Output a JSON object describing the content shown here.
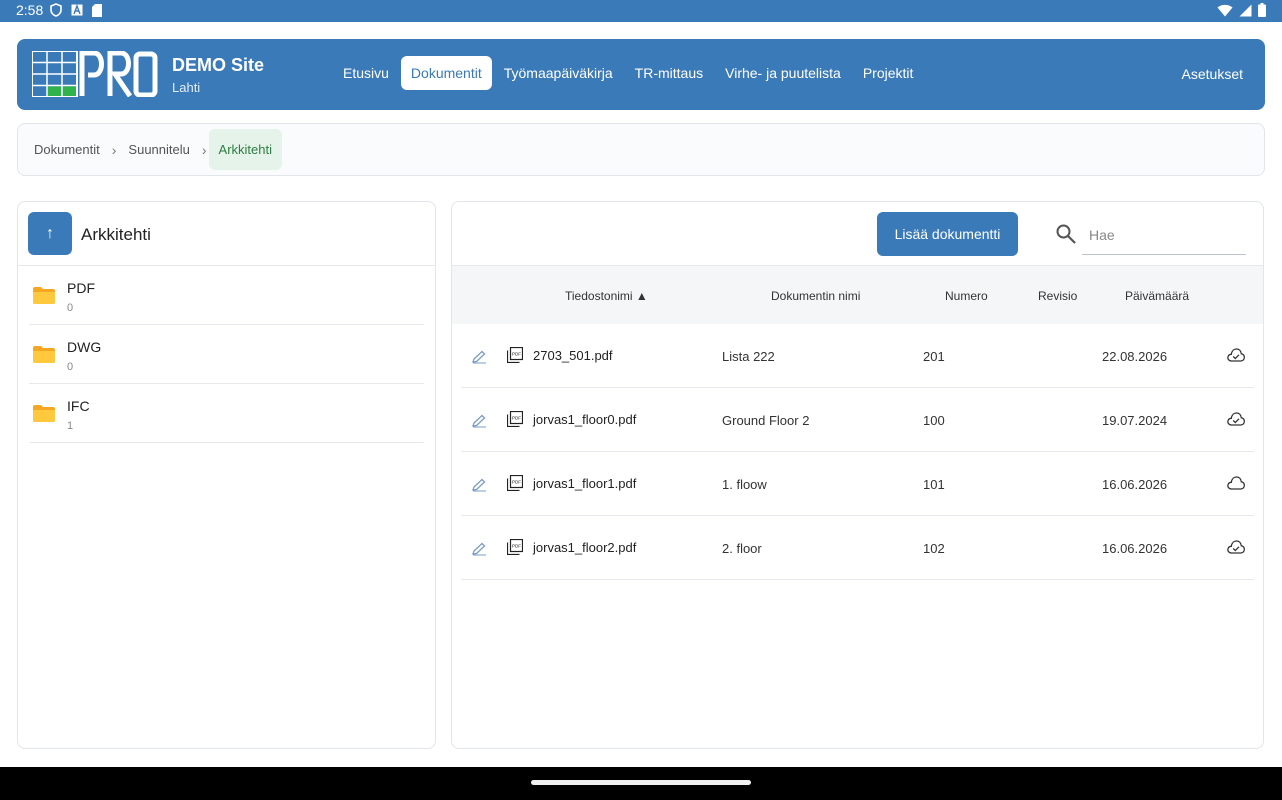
{
  "status_bar": {
    "time": "2:58"
  },
  "header": {
    "site_name": "DEMO Site",
    "site_city": "Lahti",
    "nav": [
      "Etusivu",
      "Dokumentit",
      "Työmaapäiväkirja",
      "TR-mittaus",
      "Virhe- ja puutelista",
      "Projektit"
    ],
    "active_nav": "Dokumentit",
    "settings_label": "Asetukset",
    "brand_color": "#3a7ab8"
  },
  "breadcrumb": [
    "Dokumentit",
    "Suunnitelu",
    "Arkkitehti"
  ],
  "left_panel": {
    "up_label": "↑",
    "title": "Arkkitehti",
    "folders": [
      {
        "name": "PDF",
        "count": "0"
      },
      {
        "name": "DWG",
        "count": "0"
      },
      {
        "name": "IFC",
        "count": "1"
      }
    ]
  },
  "right_panel": {
    "add_button": "Lisää dokumentti",
    "search_placeholder": "Hae",
    "columns": {
      "filename": "Tiedostonimi ▲",
      "doc_name": "Dokumentin nimi",
      "number": "Numero",
      "revision": "Revisio",
      "date": "Päivämäärä"
    },
    "rows": [
      {
        "filename": "2703_501.pdf",
        "doc_name": "Lista 222",
        "number": "201",
        "revision": "",
        "date": "22.08.2026",
        "cloud": "downloaded"
      },
      {
        "filename": "jorvas1_floor0.pdf",
        "doc_name": "Ground Floor 2",
        "number": "100",
        "revision": "",
        "date": "19.07.2024",
        "cloud": "downloaded"
      },
      {
        "filename": "jorvas1_floor1.pdf",
        "doc_name": "1. floow",
        "number": "101",
        "revision": "",
        "date": "16.06.2026",
        "cloud": "not-downloaded"
      },
      {
        "filename": "jorvas1_floor2.pdf",
        "doc_name": "2. floor",
        "number": "102",
        "revision": "",
        "date": "16.06.2026",
        "cloud": "downloaded"
      }
    ]
  }
}
